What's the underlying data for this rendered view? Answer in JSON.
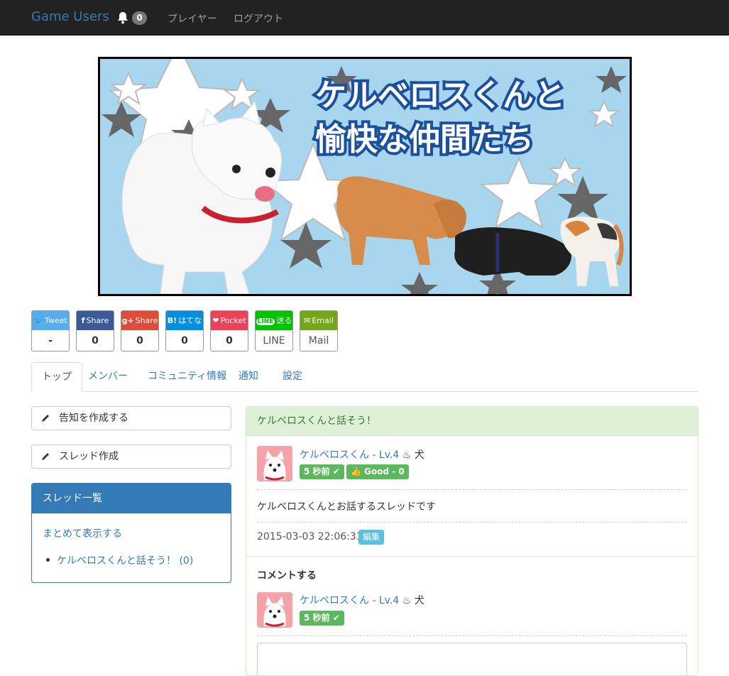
{
  "navbar": {
    "brand": "Game Users",
    "notification_count": "0",
    "links": [
      "プレイヤー",
      "ログアウト"
    ]
  },
  "banner": {
    "title_line1": "ケルベロスくんと",
    "title_line2": "愉快な仲間たち"
  },
  "share": [
    {
      "icon": "twitter-icon",
      "label": "Tweet",
      "count": "-",
      "color": "#55acee"
    },
    {
      "icon": "facebook-icon",
      "label": "Share",
      "count": "0",
      "color": "#3b5998"
    },
    {
      "icon": "googleplus-icon",
      "label": "Share",
      "count": "0",
      "color": "#dd4b39"
    },
    {
      "icon": "hatena-icon",
      "label": "はてな",
      "count": "0",
      "color": "#008fde"
    },
    {
      "icon": "pocket-icon",
      "label": "Pocket",
      "count": "0",
      "color": "#ee4056"
    },
    {
      "icon": "line-icon",
      "label": "送る",
      "count": "LINE",
      "color": "#00c300"
    },
    {
      "icon": "email-icon",
      "label": "Email",
      "count": "Mail",
      "color": "#74a619"
    }
  ],
  "share_icons": {
    "twitter": "🐦",
    "facebook": "f",
    "googleplus": "g+",
    "hatena": "B!",
    "pocket": "❤",
    "line": "LINE",
    "email": "✉"
  },
  "tabs": [
    "トップ",
    "メンバー",
    "コミュニティ情報",
    "通知",
    "設定"
  ],
  "left": {
    "create_notice": "告知を作成する",
    "create_thread": "スレッド作成",
    "thread_list_title": "スレッド一覧",
    "show_all": "まとめて表示する",
    "thread_item": "ケルベロスくんと話そう！",
    "thread_count": "(0)"
  },
  "thread": {
    "title": "ケルベロスくんと話そう！",
    "post": {
      "user": "ケルベロスくん - Lv.4",
      "flame": "♨",
      "tag": "犬",
      "time_label": "5 秒前 ✔",
      "good_label": "👍 Good - 0",
      "body": "ケルベロスくんとお話するスレッドです",
      "date": "2015-03-03 22:06:31",
      "edit": "編集"
    },
    "comment_heading": "コメントする",
    "comment_user": "ケルベロスくん - Lv.4",
    "comment_flame": "♨",
    "comment_tag": "犬",
    "comment_time_label": "5 秒前 ✔"
  }
}
